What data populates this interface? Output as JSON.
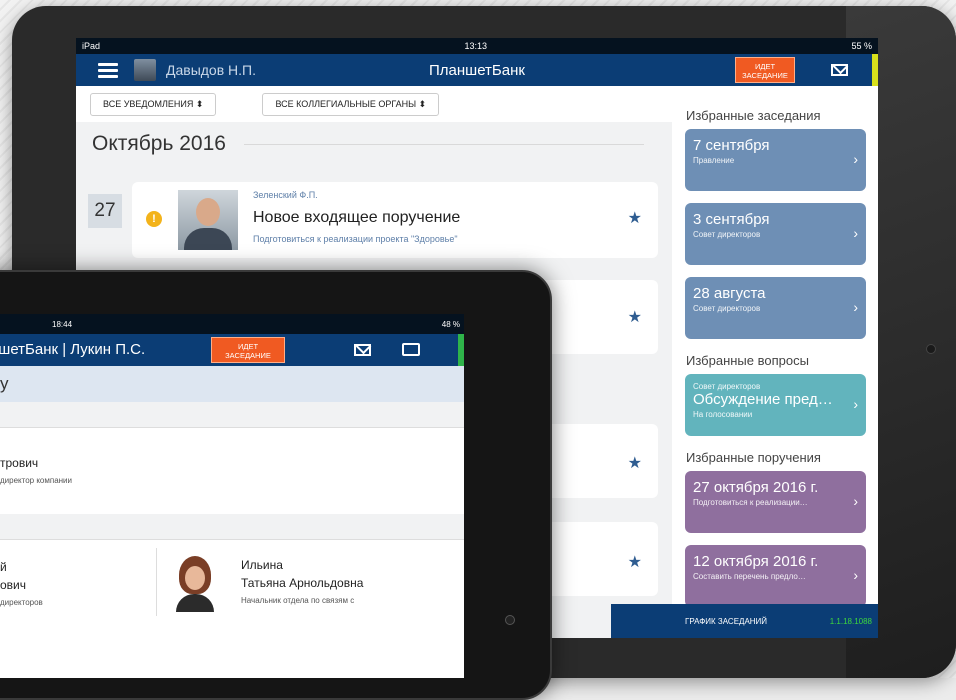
{
  "back": {
    "status": {
      "left": "iPad",
      "time": "13:13",
      "battery": "55 %"
    },
    "header": {
      "user": "Давыдов Н.П.",
      "title": "ПланшетБанк",
      "live_line1": "ИДЕТ",
      "live_line2": "ЗАСЕДАНИЕ"
    },
    "filters": {
      "notifications": "ВСЕ УВЕДОМЛЕНИЯ",
      "bodies": "ВСЕ КОЛЛЕГИАЛЬНЫЕ ОРГАНЫ"
    },
    "month": "Октябрь 2016",
    "day": "27",
    "card": {
      "author": "Зеленский Ф.П.",
      "title": "Новое входящее поручение",
      "subtitle": "Подготовиться к реализации проекта \"Здоровье\""
    },
    "sidebar": {
      "fav_meetings": "Избранные заседания",
      "meetings": [
        {
          "date": "7 сентября",
          "body": "Правление"
        },
        {
          "date": "3 сентября",
          "body": "Совет директоров"
        },
        {
          "date": "28 августа",
          "body": "Совет директоров"
        }
      ],
      "fav_questions": "Избранные вопросы",
      "question": {
        "body": "Совет директоров",
        "title": "Обсуждение пред…",
        "status": "На голосовании"
      },
      "fav_tasks": "Избранные поручения",
      "tasks": [
        {
          "date": "27 октября 2016 г.",
          "text": "Подготовиться к реализации…"
        },
        {
          "date": "12 октября 2016 г.",
          "text": "Составить перечень предло…"
        }
      ]
    },
    "bottom": {
      "schedule": "ГРАФИК ЗАСЕДАНИЙ",
      "version": "1.1.18.1088"
    },
    "colors": {
      "navy": "#0b3d75",
      "orange": "#f05a22",
      "blue_card": "#6e8fb5",
      "teal_card": "#62b4bd",
      "purple_card": "#8f6f9e"
    }
  },
  "front": {
    "status": {
      "time": "18:44",
      "battery": "48 %"
    },
    "header": {
      "title": "ншетБанк | Лукин П.С.",
      "live_line1": "ИДЕТ",
      "live_line2": "ЗАСЕДАНИЕ"
    },
    "band": "у",
    "person1": {
      "name": "трович",
      "role": "директор компании"
    },
    "person2": {
      "name_line1": "й",
      "name_line2": "ович",
      "role": "директоров"
    },
    "person3": {
      "name_line1": "Ильина",
      "name_line2": "Татьяна Арнольдовна",
      "role": "Начальник отдела по связям с"
    }
  }
}
